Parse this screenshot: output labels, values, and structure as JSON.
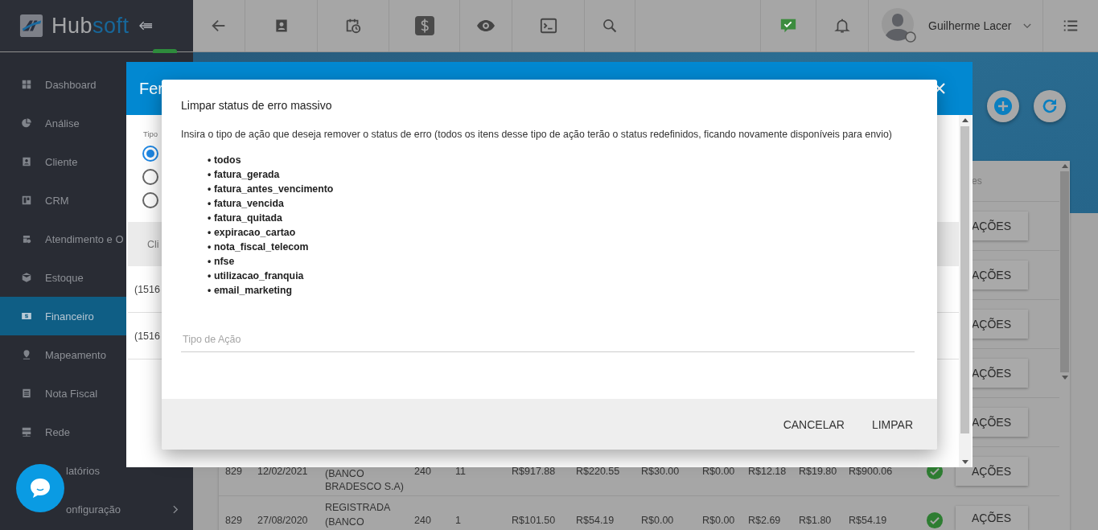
{
  "topbar": {
    "logo": [
      "Hub",
      "soft"
    ],
    "user": {
      "name": "Guilherme Lacer"
    }
  },
  "sidebar": {
    "items": [
      {
        "label": "Dashboard",
        "selected": false,
        "has_submenu": false
      },
      {
        "label": "Análise",
        "selected": false,
        "has_submenu": false
      },
      {
        "label": "Cliente",
        "selected": false,
        "has_submenu": false
      },
      {
        "label": "CRM",
        "selected": false,
        "has_submenu": false
      },
      {
        "label": "Atendimento e O",
        "selected": false,
        "has_submenu": false
      },
      {
        "label": "Estoque",
        "selected": false,
        "has_submenu": false
      },
      {
        "label": "Financeiro",
        "selected": true,
        "has_submenu": false
      },
      {
        "label": "Mapeamento",
        "selected": false,
        "has_submenu": false
      },
      {
        "label": "Nota Fiscal",
        "selected": false,
        "has_submenu": false
      },
      {
        "label": "Rede",
        "selected": false,
        "has_submenu": false
      },
      {
        "label": "latórios",
        "selected": false,
        "has_submenu": false
      },
      {
        "label": "onfiguração",
        "selected": false,
        "has_submenu": true
      }
    ]
  },
  "table": {
    "column_header": "es",
    "rows": [
      {
        "action": "AÇÕES"
      },
      {
        "action": "AÇÕES"
      },
      {
        "action": "AÇÕES"
      },
      {
        "action": "AÇÕES"
      },
      {
        "action": "AÇÕES"
      },
      {
        "number": "829",
        "date": "12/02/2021",
        "bank": {
          "lines": [
            "(BANCO",
            "BRADESCO S.A)"
          ]
        },
        "qty_1": "240",
        "qty_2": "11",
        "amounts": [
          "R$917.88",
          "R$220.55",
          "R$30.00",
          "R$0.00",
          "R$12.18",
          "R$19.80",
          "R$900.06"
        ],
        "paid": true,
        "action": "AÇÕES"
      },
      {
        "number": "829",
        "date": "27/08/2020",
        "bank": {
          "lines": [
            "REGISTRADA",
            "(BANCO"
          ]
        },
        "qty_1": "240",
        "qty_2": "1",
        "amounts": [
          "R$101.50",
          "R$54.19",
          "R$0.00",
          "R$0.00",
          "R$2.69",
          "R$1.80",
          "R$54.19"
        ],
        "paid": true,
        "action": "AÇÕES"
      }
    ]
  },
  "back_dialog": {
    "title": "Fer",
    "type_label": "Tipo",
    "options": [
      {
        "selected": true
      },
      {
        "selected": false
      },
      {
        "selected": false
      }
    ],
    "column_header": "Cli",
    "rows": [
      "(1516",
      "(1516"
    ]
  },
  "dialog": {
    "title": "Limpar status de erro massivo",
    "description": "Insira o tipo de ação que deseja remover o status de erro (todos os itens desse tipo de ação terão o status redefinidos, ficando novamente disponíveis para envio)",
    "bullet": "•",
    "action_types": [
      "todos",
      "fatura_gerada",
      "fatura_antes_vencimento",
      "fatura_vencida",
      "fatura_quitada",
      "expiracao_cartao",
      "nota_fiscal_telecom",
      "nfse",
      "utilizacao_franquia",
      "email_marketing"
    ],
    "field": {
      "placeholder": "Tipo de Ação"
    },
    "buttons": [
      "CANCELAR",
      "LIMPAR"
    ]
  }
}
